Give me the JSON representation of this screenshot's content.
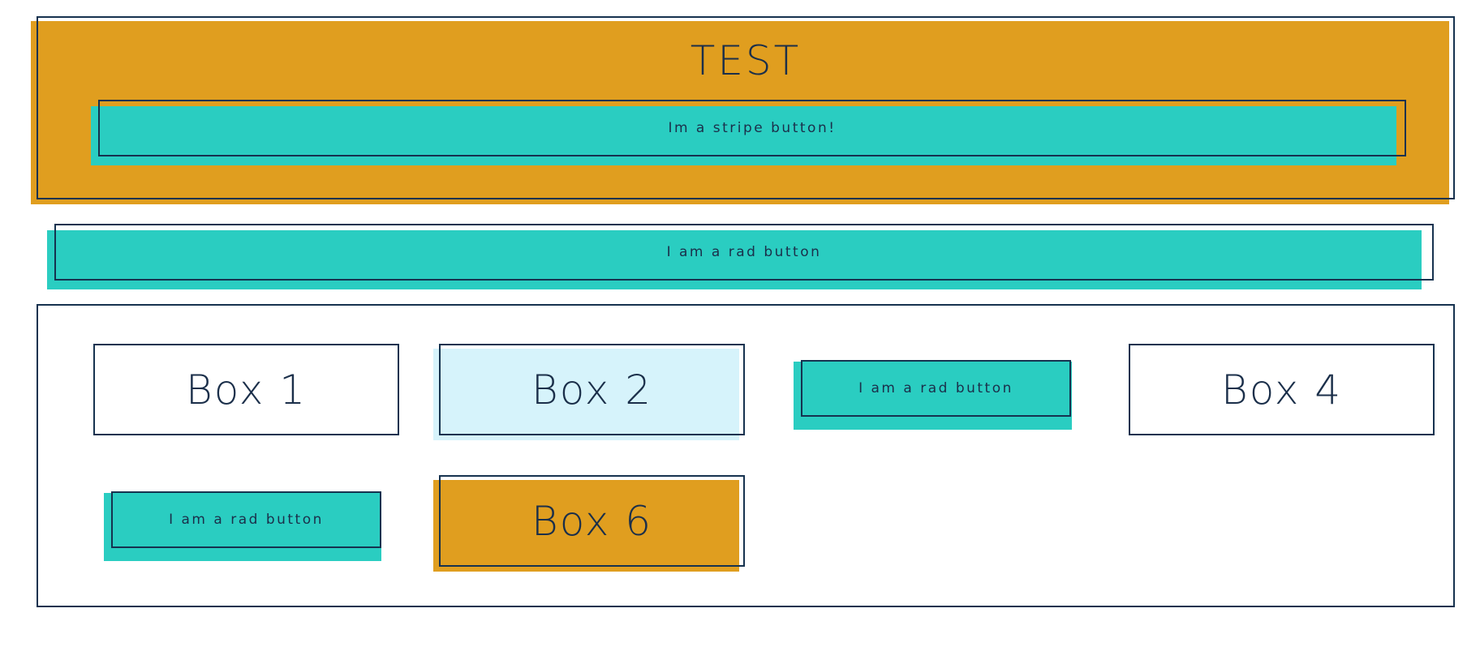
{
  "hero": {
    "title": "TEST",
    "button_label": "Im a stripe button!"
  },
  "rad_button": {
    "label": "I am a rad button"
  },
  "grid": {
    "box1": "Box 1",
    "box2": "Box 2",
    "rad3": "I am a rad button",
    "box4": "Box 4",
    "rad5": "I am a rad button",
    "box6": "Box 6"
  },
  "colors": {
    "orange": "#e09e1f",
    "teal": "#2acdc1",
    "light_blue": "#d6f3fb",
    "navy": "#16324f"
  }
}
